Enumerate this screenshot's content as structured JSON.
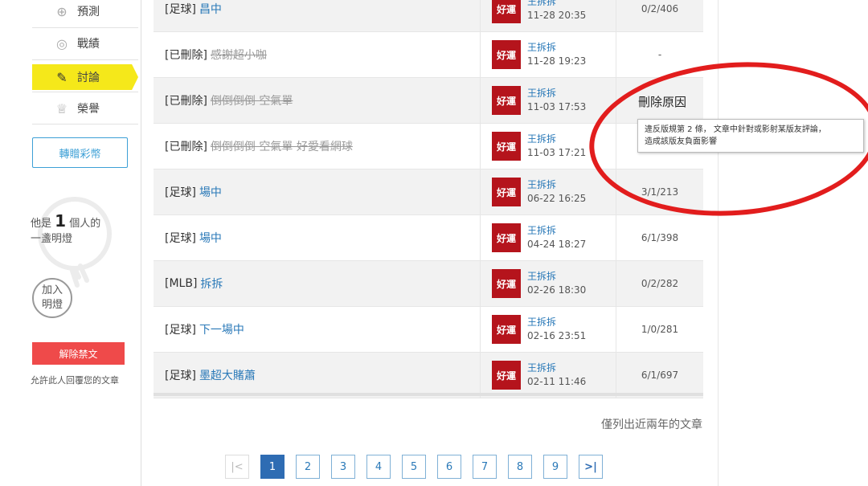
{
  "sidebar": {
    "items": [
      {
        "label": "預測",
        "icon": "target-icon"
      },
      {
        "label": "戰績",
        "icon": "speech-icon"
      },
      {
        "label": "討論",
        "icon": "pencil-icon"
      },
      {
        "label": "榮譽",
        "icon": "medal-icon"
      }
    ],
    "gift_button": "轉贈彩幣",
    "light": {
      "prefix": "他是",
      "count": "1",
      "suffix": "個人的",
      "line2": "一盞明燈"
    },
    "join_button": "加入明燈",
    "unban_button": "解除禁文",
    "unban_note": "允許此人回覆您的文章"
  },
  "posts": [
    {
      "category": "[足球]",
      "title": "昌中",
      "deleted": false,
      "author": "王拆拆",
      "time": "11-28 20:35",
      "stats": "0/2/406"
    },
    {
      "category": "[已刪除]",
      "title": "感謝超小咖",
      "deleted": true,
      "author": "王拆拆",
      "time": "11-28 19:23",
      "stats": "-"
    },
    {
      "category": "[已刪除]",
      "title": "倒倒倒倒 空氣單",
      "deleted": true,
      "author": "王拆拆",
      "time": "11-03 17:53",
      "stats": ""
    },
    {
      "category": "[已刪除]",
      "title": "倒倒倒倒 空氣單 好愛看網球",
      "deleted": true,
      "author": "王拆拆",
      "time": "11-03 17:21",
      "stats": ""
    },
    {
      "category": "[足球]",
      "title": "場中",
      "deleted": false,
      "author": "王拆拆",
      "time": "06-22 16:25",
      "stats": "3/1/213"
    },
    {
      "category": "[足球]",
      "title": "場中",
      "deleted": false,
      "author": "王拆拆",
      "time": "04-24 18:27",
      "stats": "6/1/398"
    },
    {
      "category": "[MLB]",
      "title": "拆拆",
      "deleted": false,
      "author": "王拆拆",
      "time": "02-26 18:30",
      "stats": "0/2/282"
    },
    {
      "category": "[足球]",
      "title": "下一場中",
      "deleted": false,
      "author": "王拆拆",
      "time": "02-16 23:51",
      "stats": "1/0/281"
    },
    {
      "category": "[足球]",
      "title": "墨超大賭蕭",
      "deleted": false,
      "author": "王拆拆",
      "time": "02-11 11:46",
      "stats": "6/1/697"
    }
  ],
  "avatar_text": "好運",
  "delete_reason": {
    "title": "刪除原因",
    "line1": "違反版規第 2 條， 文章中針對或影射某版友評論，",
    "line2": "造成該版友負面影響"
  },
  "note": "僅列出近兩年的文章",
  "pagination": {
    "first": "|<",
    "pages": [
      "1",
      "2",
      "3",
      "4",
      "5",
      "6",
      "7",
      "8",
      "9"
    ],
    "last": ">|",
    "current": "1"
  },
  "colors": {
    "accent": "#f5e81a",
    "link": "#2a79b8",
    "annotation": "#e21d1d",
    "unban": "#ef4a4a"
  }
}
